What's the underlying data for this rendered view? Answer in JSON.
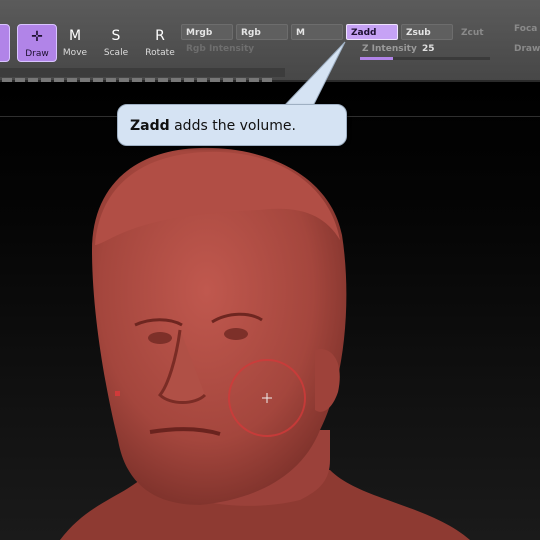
{
  "toolbar": {
    "tools": [
      {
        "label": "Draw",
        "icon": "draw-icon",
        "active": true
      },
      {
        "label": "Move",
        "icon": "move-icon",
        "glyph": "M",
        "active": false
      },
      {
        "label": "Scale",
        "icon": "scale-icon",
        "glyph": "S",
        "active": false
      },
      {
        "label": "Rotate",
        "icon": "rotate-icon",
        "glyph": "R",
        "active": false
      }
    ],
    "modes": [
      "Mrgb",
      "Rgb",
      "M",
      "Zadd",
      "Zsub",
      "Zcut"
    ],
    "active_mode": "Zadd",
    "rgb_intensity_label": "Rgb Intensity",
    "z_intensity_label": "Z Intensity",
    "z_intensity_value": "25",
    "z_intensity_fraction": 0.25,
    "right_labels": [
      "Foca",
      "Draw"
    ]
  },
  "callout": {
    "bold": "Zadd",
    "text": " adds the volume."
  },
  "colors": {
    "accent": "#b184e8",
    "sculpt": "#a8483f",
    "brush_ring": "#d13a3a"
  }
}
